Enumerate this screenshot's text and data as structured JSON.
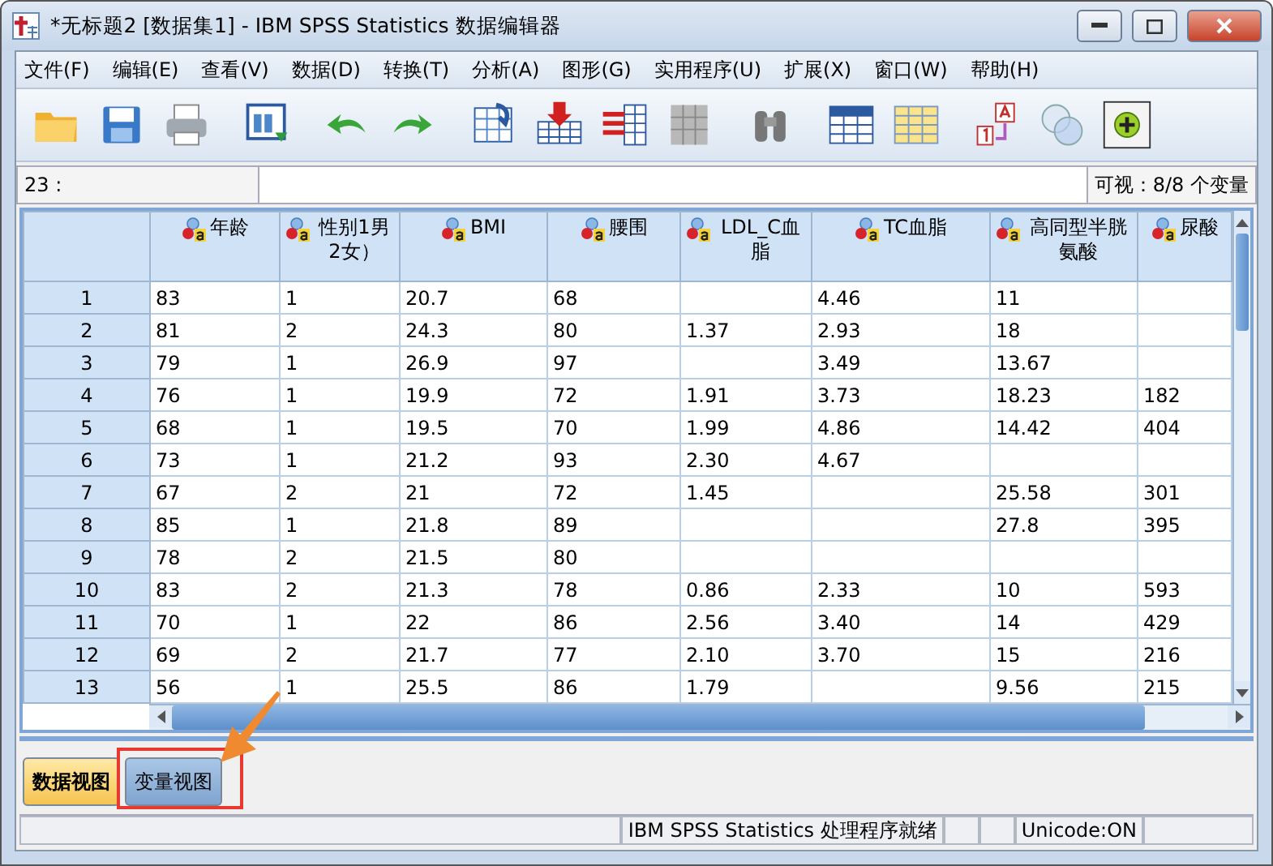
{
  "window": {
    "title": "*无标题2 [数据集1] - IBM SPSS Statistics 数据编辑器"
  },
  "menu": [
    "文件(F)",
    "编辑(E)",
    "查看(V)",
    "数据(D)",
    "转换(T)",
    "分析(A)",
    "图形(G)",
    "实用程序(U)",
    "扩展(X)",
    "窗口(W)",
    "帮助(H)"
  ],
  "cell_editor": {
    "reference": "23 :",
    "visible": "可视：8/8 个变量"
  },
  "table": {
    "columns": [
      "年龄",
      "性别1男2女）",
      "BMI",
      "腰围",
      "LDL_C血脂",
      "TC血脂",
      "高同型半胱氨酸",
      "尿酸"
    ],
    "rows": [
      {
        "row": "1",
        "cells": [
          "83",
          "1",
          "20.7",
          "68",
          null,
          "4.46",
          "11",
          null
        ]
      },
      {
        "row": "2",
        "cells": [
          "81",
          "2",
          "24.3",
          "80",
          "1.37",
          "2.93",
          "18",
          null
        ]
      },
      {
        "row": "3",
        "cells": [
          "79",
          "1",
          "26.9",
          "97",
          null,
          "3.49",
          "13.67",
          null
        ]
      },
      {
        "row": "4",
        "cells": [
          "76",
          "1",
          "19.9",
          "72",
          "1.91",
          "3.73",
          "18.23",
          "182"
        ]
      },
      {
        "row": "5",
        "cells": [
          "68",
          "1",
          "19.5",
          "70",
          "1.99",
          "4.86",
          "14.42",
          "404"
        ]
      },
      {
        "row": "6",
        "cells": [
          "73",
          "1",
          "21.2",
          "93",
          "2.30",
          "4.67",
          null,
          null
        ]
      },
      {
        "row": "7",
        "cells": [
          "67",
          "2",
          "21",
          "72",
          "1.45",
          null,
          "25.58",
          "301"
        ]
      },
      {
        "row": "8",
        "cells": [
          "85",
          "1",
          "21.8",
          "89",
          null,
          null,
          "27.8",
          "395"
        ]
      },
      {
        "row": "9",
        "cells": [
          "78",
          "2",
          "21.5",
          "80",
          null,
          null,
          null,
          null
        ]
      },
      {
        "row": "10",
        "cells": [
          "83",
          "2",
          "21.3",
          "78",
          "0.86",
          "2.33",
          "10",
          "593"
        ]
      },
      {
        "row": "11",
        "cells": [
          "70",
          "1",
          "22",
          "86",
          "2.56",
          "3.40",
          "14",
          "429"
        ]
      },
      {
        "row": "12",
        "cells": [
          "69",
          "2",
          "21.7",
          "77",
          "2.10",
          "3.70",
          "15",
          "216"
        ]
      },
      {
        "row": "13",
        "cells": [
          "56",
          "1",
          "25.5",
          "86",
          "1.79",
          null,
          "9.56",
          "215"
        ]
      }
    ]
  },
  "view_tabs": [
    {
      "label": "数据视图",
      "selected": true
    },
    {
      "label": "变量视图",
      "selected": false
    }
  ],
  "status_bar": [
    "IBM SPSS Statistics 处理程序就绪",
    "Unicode:ON"
  ]
}
